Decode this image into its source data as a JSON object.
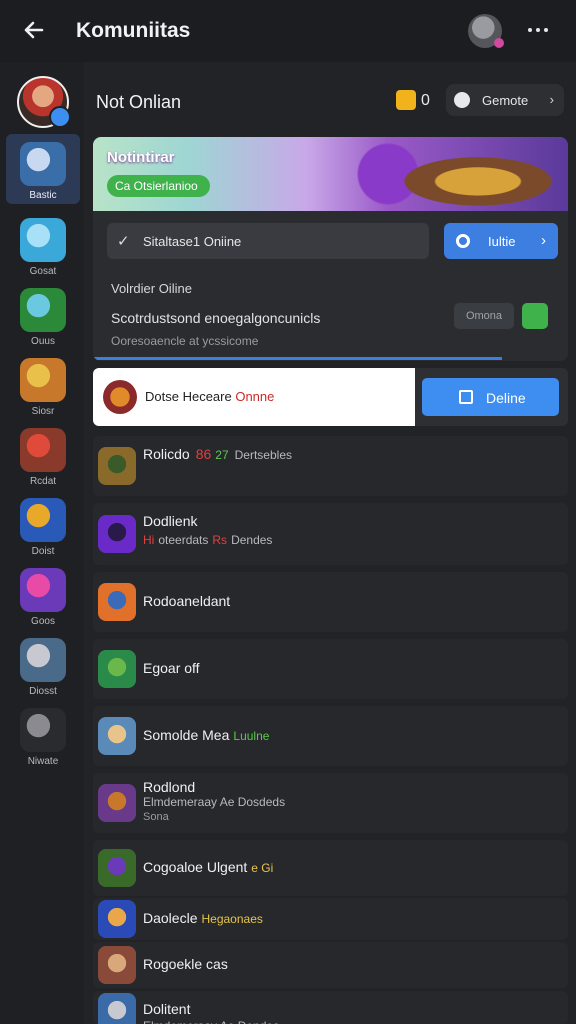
{
  "topbar": {
    "title": "Komuniitas",
    "back_icon": "arrow-left-icon",
    "menu_icon": "more-dots-icon"
  },
  "sidebar": {
    "items": [
      {
        "label": "Bastic",
        "color1": "#3a6ea8",
        "color2": "#c8d8f0"
      },
      {
        "label": "Gosat",
        "color1": "#3aa8d8",
        "color2": "#a8e0f8"
      },
      {
        "label": "Ouus",
        "color1": "#2a8a3a",
        "color2": "#6ac8e0"
      },
      {
        "label": "Siosr",
        "color1": "#c8782a",
        "color2": "#e8c04a"
      },
      {
        "label": "Rcdat",
        "color1": "#8a3a2a",
        "color2": "#e04a3a"
      },
      {
        "label": "Doist",
        "color1": "#2a5ab8",
        "color2": "#e8a82a"
      },
      {
        "label": "Goos",
        "color1": "#6a3ab8",
        "color2": "#e84aa8"
      },
      {
        "label": "Diosst",
        "color1": "#4a6a8a",
        "color2": "#c8c8d0"
      },
      {
        "label": "Niwate",
        "color1": "#2a2b2f",
        "color2": "#8a8a90"
      }
    ]
  },
  "header": {
    "title": "Not Onlian",
    "coin_count": "0",
    "button_label": "Gemote",
    "button_chevron": "›"
  },
  "card": {
    "banner_title": "Notintirar",
    "banner_pill": "Ca Otsierlanioo",
    "input_icon": "✓",
    "input_text": "Sitaltase1 Oniine",
    "blue_button": "Iultie",
    "blue_chevron": "›",
    "status": "Volrdier Oiline",
    "desc": "Scotrdustsond enoegalgoncunicls",
    "sub": "Ooresoaencle at ycssicome",
    "small_button": "Omona",
    "progress": 0.86
  },
  "highlight_row": {
    "name_prefix": "Dotse Heceare",
    "name_red": "Onnne",
    "button_label": "Deline"
  },
  "list": [
    {
      "name": "Rolicdo",
      "extra_red": "86",
      "extra_green": "27",
      "line2": "Dertsebles",
      "colors": [
        "#8a6a2a",
        "#3a5a2a"
      ]
    },
    {
      "name": "Dodlienk",
      "line2_red": "Hi",
      "line2": "oteerdats",
      "line2_red2": "Rs",
      "line2_end": "Dendes",
      "colors": [
        "#6a2ac8",
        "#2a1a4a"
      ]
    },
    {
      "name": "Rodoaneldant",
      "colors": [
        "#e0702a",
        "#3a6ab8"
      ]
    },
    {
      "name": "Egoar off",
      "colors": [
        "#2a8a4a",
        "#6ab84a"
      ]
    },
    {
      "name": "Somolde Mea",
      "extra_green": "Luulne",
      "colors": [
        "#5a8ab8",
        "#e8c48a"
      ]
    },
    {
      "name": "Rodlond",
      "line2": "Elmdemeraay Ae Dosdeds",
      "line3": "Sona",
      "colors": [
        "#6a3a8a",
        "#c8782a"
      ]
    },
    {
      "name": "Cogoaloe Ulgent",
      "extra_yellow": "e Gi",
      "colors": [
        "#3a6a2a",
        "#6a3ab8"
      ]
    },
    {
      "name": "Daolecle",
      "extra_yellow": "Hegaonaes",
      "colors": [
        "#2a4ab8",
        "#e8a84a"
      ]
    },
    {
      "name": "Rogoekle cas",
      "colors": [
        "#8a4a3a",
        "#d8a87a"
      ]
    },
    {
      "name": "Dolitent",
      "line2": "Elmdemeraay Ae Dendes",
      "colors": [
        "#3a6aa8",
        "#c8c8d0"
      ]
    }
  ]
}
